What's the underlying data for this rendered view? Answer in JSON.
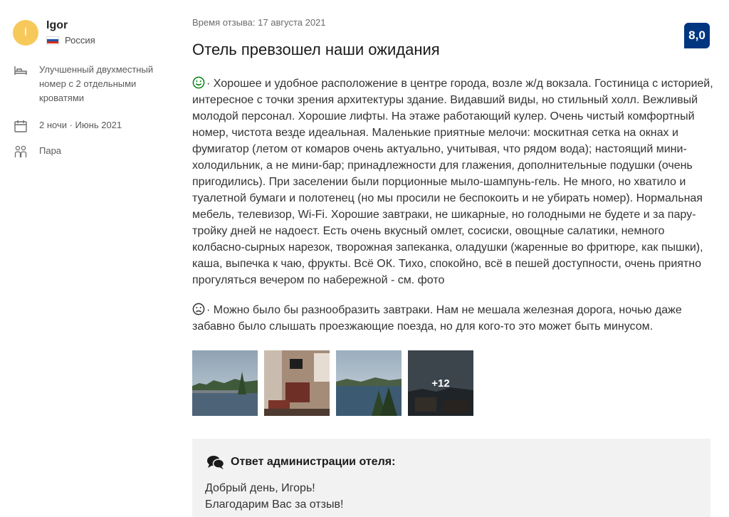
{
  "user": {
    "initial": "I",
    "name": "Igor",
    "country": "Россия",
    "flag_colors": [
      "#ffffff",
      "#1c57a7",
      "#d52b1e"
    ]
  },
  "stay": {
    "room": "Улучшенный двухместный номер с 2 отдельными кроватями",
    "nights_date": "2 ночи · Июнь 2021",
    "traveler_type": "Пара"
  },
  "review": {
    "date": "Время отзыва: 17 августа 2021",
    "title": "Отель превзошел наши ожидания",
    "score": "8,0",
    "positive": "· Хорошее и удобное расположение в центре города, возле ж/д вокзала. Гостиница с историей, интересное с точки зрения архитектуры здание. Видавший виды, но стильный холл. Вежливый молодой персонал. Хорошие лифты. На этаже работающий кулер. Очень чистый комфортный номер, чистота везде идеальная. Маленькие приятные мелочи: москитная сетка на окнах и фумигатор (летом от комаров очень актуально, учитывая, что рядом вода); настоящий мини-холодильник, а не мини-бар; принадлежности для глажения, дополнительные подушки (очень пригодились). При заселении были порционные мыло-шампунь-гель. Не много, но хватило и туалетной бумаги и полотенец (но мы просили не беспокоить и не убирать номер). Нормальная мебель, телевизор, Wi-Fi. Хорошие завтраки, не шикарные, но голодными не будете и за пару-тройку дней не надоест. Есть очень вкусный омлет, сосиски, овощные салатики, немного колбасно-сырных нарезок, творожная запеканка, оладушки (жаренные во фритюре, как пышки), каша, выпечка к чаю, фрукты. Всё ОК. Тихо, спокойно, всё в пешей доступности, очень приятно прогуляться вечером по набережной - см. фото",
    "negative": "· Можно было бы разнообразить завтраки. Нам не мешала железная дорога, ночью даже забавно было слышать проезжающие поезда, но для кого-то это может быть минусом."
  },
  "photos": {
    "more_label": "+12"
  },
  "reply": {
    "heading": "Ответ администрации отеля:",
    "line1": "Добрый день, Игорь!",
    "line2": "Благодарим Вас за отзыв!"
  },
  "colors": {
    "score_bg": "#003580",
    "avatar_bg": "#f7c95b",
    "positive_icon": "#008009",
    "reply_bg": "#f2f2f2"
  }
}
